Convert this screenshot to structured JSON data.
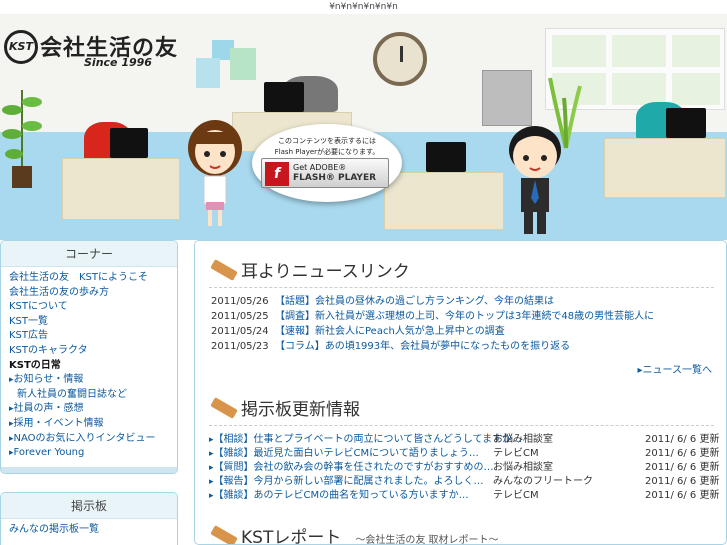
{
  "top_bar": {
    "text": "¥n¥n¥n¥n¥n¥n"
  },
  "header": {
    "logo_mark": "KST",
    "logo_title": "会社生活の友",
    "logo_since": "Since 1996",
    "flash_message_line1": "このコンテンツを表示するには",
    "flash_message_line2": "Flash Playerが必要になります。",
    "flash_button_top": "Get ADOBE®",
    "flash_button_bottom": "FLASH® PLAYER",
    "flash_icon": "f"
  },
  "sidebar": {
    "corner_title": "コーナー",
    "corner_items": [
      {
        "label": "会社生活の友　KSTにようこそ",
        "style": "link"
      },
      {
        "label": "会社生活の友の歩み方",
        "style": "link"
      },
      {
        "label": "KSTについて",
        "style": "link"
      },
      {
        "label": "KST一覧",
        "style": "link"
      },
      {
        "label": "KST広告",
        "style": "link"
      },
      {
        "label": "KSTのキャラクタ",
        "style": "link"
      },
      {
        "label": "KSTの日常",
        "style": "plain"
      },
      {
        "label": "お知らせ・情報",
        "style": "arrow"
      },
      {
        "label": "新人社員の奮闘日誌など",
        "style": "indent"
      },
      {
        "label": "社員の声・感想",
        "style": "arrow"
      },
      {
        "label": "採用・イベント情報",
        "style": "arrow"
      },
      {
        "label": "NAOのお気に入りインタビュー",
        "style": "arrow"
      },
      {
        "label": "Forever Young",
        "style": "arrow"
      }
    ],
    "bbs_title": "掲示板",
    "bbs_items": [
      {
        "label": "みんなの掲示板一覧"
      }
    ]
  },
  "main": {
    "news_title": "耳よりニュースリンク",
    "news": [
      {
        "date": "2011/05/26",
        "text": "【話題】会社員の昼休みの過ごし方ランキング、今年の結果は"
      },
      {
        "date": "2011/05/25",
        "text": "【調査】新入社員が選ぶ理想の上司、今年のトップは3年連続で48歳の男性芸能人に"
      },
      {
        "date": "2011/05/24",
        "text": "【速報】新社会人にPeach人気が急上昇中との調査"
      },
      {
        "date": "2011/05/23",
        "text": "【コラム】あの頃1993年、会社員が夢中になったものを振り返る"
      }
    ],
    "news_more": "ニュース一覧へ",
    "bbs_title": "掲示板更新情報",
    "bbs": [
      {
        "title": "【相談】仕事とプライベートの両立について皆さんどうしてますか…",
        "board": "お悩み相談室",
        "date": "2011/ 6/ 6 更新"
      },
      {
        "title": "【雑談】最近見た面白いテレビCMについて語りましょう…",
        "board": "テレビCM",
        "date": "2011/ 6/ 6 更新"
      },
      {
        "title": "【質問】会社の飲み会の幹事を任されたのですがおすすめの…",
        "board": "お悩み相談室",
        "date": "2011/ 6/ 6 更新"
      },
      {
        "title": "【報告】今月から新しい部署に配属されました。よろしく…",
        "board": "みんなのフリートーク",
        "date": "2011/ 6/ 6 更新"
      },
      {
        "title": "【雑談】あのテレビCMの曲名を知っている方いますか…",
        "board": "テレビCM",
        "date": "2011/ 6/ 6 更新"
      }
    ],
    "report_title": "KSTレポート",
    "report_sub": "〜会社生活の友 取材レポート〜"
  }
}
